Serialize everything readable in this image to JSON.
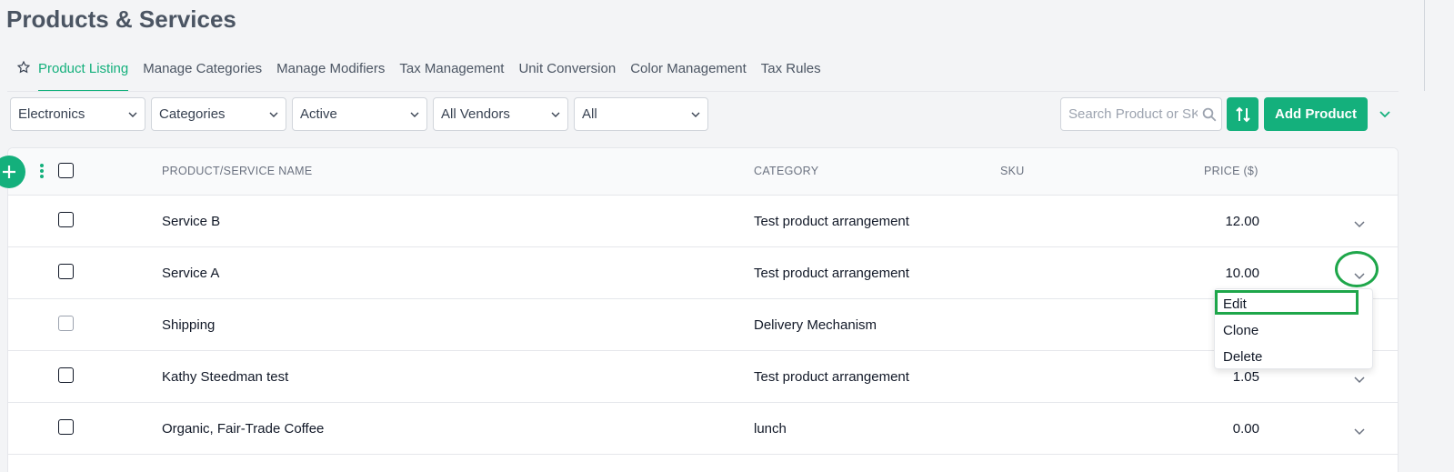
{
  "page": {
    "title": "Products & Services"
  },
  "tabs": [
    {
      "label": "Product Listing",
      "active": true
    },
    {
      "label": "Manage Categories"
    },
    {
      "label": "Manage Modifiers"
    },
    {
      "label": "Tax Management"
    },
    {
      "label": "Unit Conversion"
    },
    {
      "label": "Color Management"
    },
    {
      "label": "Tax Rules"
    }
  ],
  "filters": {
    "category_group": "Electronics",
    "categories": "Categories",
    "status": "Active",
    "vendors": "All Vendors",
    "type": "All"
  },
  "toolbar": {
    "search_placeholder": "Search Product or SKU",
    "add_label": "Add Product"
  },
  "table": {
    "headers": {
      "name": "PRODUCT/SERVICE NAME",
      "category": "CATEGORY",
      "sku": "SKU",
      "price": "PRICE ($)"
    },
    "rows": [
      {
        "name": "Service B",
        "category": "Test product arrangement",
        "sku": "",
        "price": "12.00"
      },
      {
        "name": "Service A",
        "category": "Test product arrangement",
        "sku": "",
        "price": "10.00"
      },
      {
        "name": "Shipping",
        "category": "Delivery Mechanism",
        "sku": "",
        "price": ""
      },
      {
        "name": "Kathy Steedman test",
        "category": "Test product arrangement",
        "sku": "",
        "price": "1.05"
      },
      {
        "name": "Organic, Fair-Trade Coffee",
        "category": "lunch",
        "sku": "",
        "price": "0.00"
      }
    ]
  },
  "row_menu": {
    "items": [
      "Edit",
      "Clone",
      "Delete"
    ]
  },
  "colors": {
    "accent": "#14b07c",
    "highlight": "#1ea64a"
  }
}
